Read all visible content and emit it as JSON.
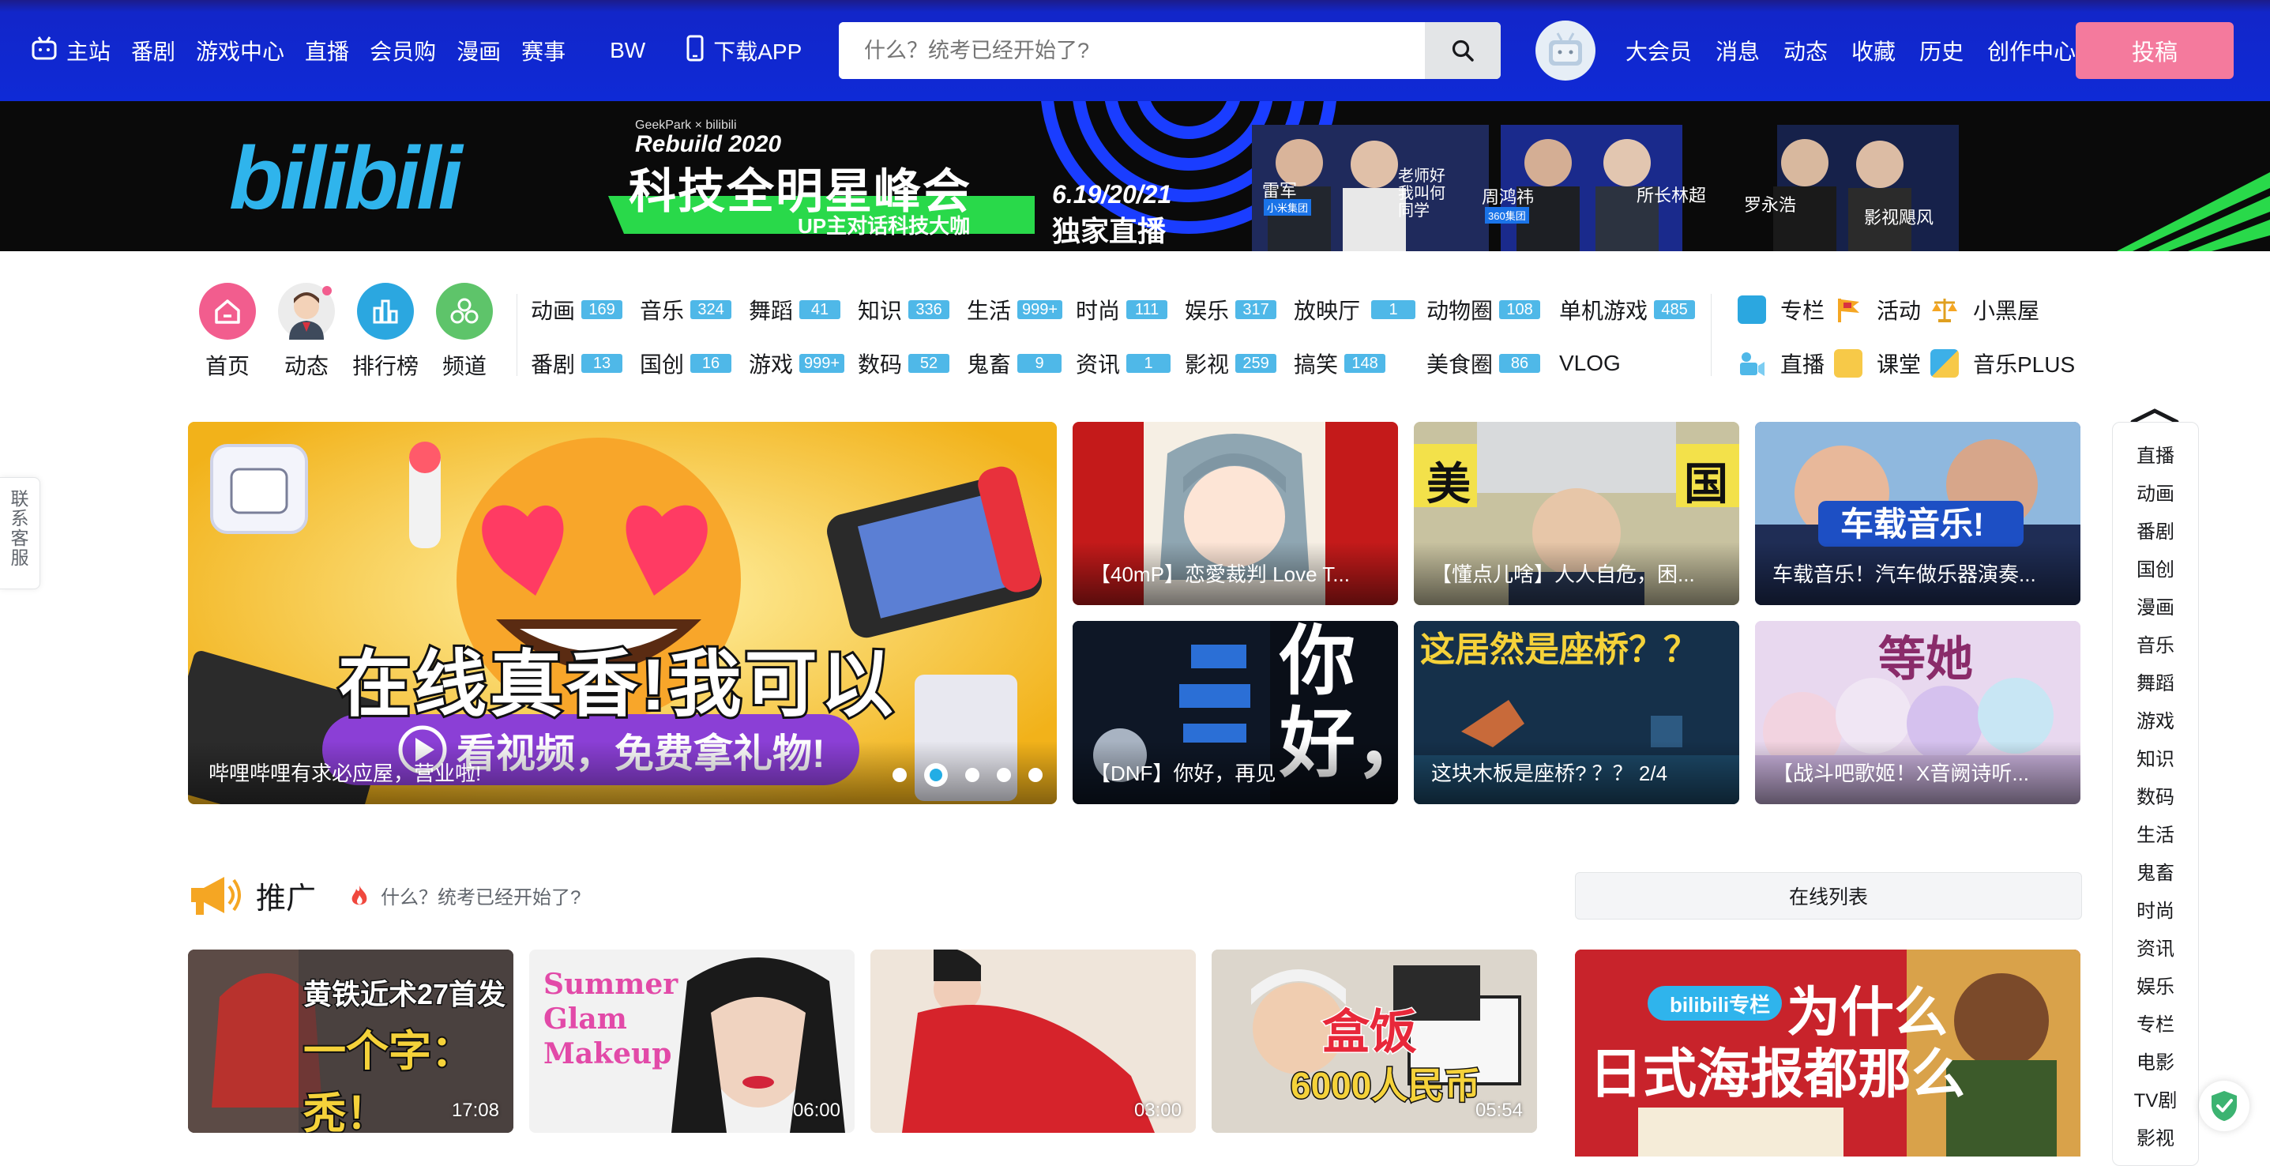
{
  "topbar": {
    "left_items": [
      {
        "label": "主站",
        "icon": "tv-logo-icon"
      },
      {
        "label": "番剧"
      },
      {
        "label": "游戏中心"
      },
      {
        "label": "直播"
      },
      {
        "label": "会员购"
      },
      {
        "label": "漫画"
      },
      {
        "label": "赛事"
      },
      {
        "label": "BW"
      },
      {
        "label": "下载APP",
        "icon": "phone-icon"
      }
    ],
    "search_placeholder": "什么？统考已经开始了?",
    "right_items": [
      "大会员",
      "消息",
      "动态",
      "收藏",
      "历史",
      "创作中心"
    ],
    "upload_label": "投稿",
    "colors": {
      "bar": "#0f2ad6",
      "upload": "#f47a9d"
    }
  },
  "banner": {
    "logo": "bilibili",
    "event_small": "GeekPark × bilibili",
    "event_name": "Rebuild 2020",
    "headline": "科技全明星峰会",
    "subline": "UP主对话科技大咖",
    "dates": "6.19/20/21",
    "live_label": "独家直播",
    "guests": [
      "雷军",
      "小米集团",
      "老师好我叫何同学",
      "周鸿祎",
      "360集团",
      "所长林超",
      "罗永浩",
      "影视飓风"
    ]
  },
  "category_nav": {
    "primary": [
      {
        "label": "首页",
        "icon": "home-icon",
        "color": "#f25d8e"
      },
      {
        "label": "动态",
        "icon": "avatar-icon",
        "color": "#e9e9e9"
      },
      {
        "label": "排行榜",
        "icon": "ranking-icon",
        "color": "#2ba7e0"
      },
      {
        "label": "频道",
        "icon": "channel-icon",
        "color": "#5ec46a"
      }
    ],
    "zones_row1": [
      {
        "label": "动画",
        "count": "169"
      },
      {
        "label": "音乐",
        "count": "324"
      },
      {
        "label": "舞蹈",
        "count": "41"
      },
      {
        "label": "知识",
        "count": "336"
      },
      {
        "label": "生活",
        "count": "999+"
      },
      {
        "label": "时尚",
        "count": "111"
      },
      {
        "label": "娱乐",
        "count": "317"
      },
      {
        "label": "放映厅",
        "count": "1"
      },
      {
        "label": "动物圈",
        "count": "108"
      },
      {
        "label": "单机游戏",
        "count": "485"
      }
    ],
    "zones_row2": [
      {
        "label": "番剧",
        "count": "13"
      },
      {
        "label": "国创",
        "count": "16"
      },
      {
        "label": "游戏",
        "count": "999+"
      },
      {
        "label": "数码",
        "count": "52"
      },
      {
        "label": "鬼畜",
        "count": "9"
      },
      {
        "label": "资讯",
        "count": "1"
      },
      {
        "label": "影视",
        "count": "259"
      },
      {
        "label": "搞笑",
        "count": "148"
      },
      {
        "label": "美食圈",
        "count": "86"
      },
      {
        "label": "VLOG",
        "count": ""
      }
    ],
    "tools": [
      {
        "label": "专栏",
        "icon": "column-icon",
        "color": "#2ba7e0"
      },
      {
        "label": "活动",
        "icon": "flag-icon",
        "color": "#f5a623"
      },
      {
        "label": "小黑屋",
        "icon": "scale-icon",
        "color": "#f5a623"
      },
      {
        "label": "直播",
        "icon": "live-icon",
        "color": "#4fb8e8"
      },
      {
        "label": "课堂",
        "icon": "classroom-icon",
        "color": "#f7c948"
      },
      {
        "label": "音乐PLUS",
        "icon": "music-plus-icon",
        "color": "#3db0e8"
      }
    ]
  },
  "carousel": {
    "headline": "在线真香!我可以",
    "button_text": "看视频，免费拿礼物!",
    "caption": "哔哩哔哩有求必应屋，营业啦!",
    "dots": 5,
    "active_dot": 2
  },
  "featured": [
    {
      "title": "【40mP】恋愛裁判 Love T..."
    },
    {
      "title": "【懂点儿啥】人人自危，困..."
    },
    {
      "title": "车载音乐！汽车做乐器演奏..."
    },
    {
      "title": "【DNF】你好，再见"
    },
    {
      "title": "这块木板是座桥? ？？ 2/4"
    },
    {
      "title": "【战斗吧歌姬！X音阙诗听..."
    }
  ],
  "promo": {
    "section_title": "推广",
    "hot_text": "什么？统考已经开始了?",
    "online_list_label": "在线列表",
    "videos": [
      {
        "duration": "17:08"
      },
      {
        "duration": "06:00"
      },
      {
        "duration": "03:00"
      },
      {
        "duration": "05:54"
      }
    ]
  },
  "side_nav": {
    "items": [
      "直播",
      "动画",
      "番剧",
      "国创",
      "漫画",
      "音乐",
      "舞蹈",
      "游戏",
      "知识",
      "数码",
      "生活",
      "鬼畜",
      "时尚",
      "资讯",
      "娱乐",
      "专栏",
      "电影",
      "TV剧",
      "影视"
    ]
  },
  "contact": {
    "label": "联系客服"
  }
}
